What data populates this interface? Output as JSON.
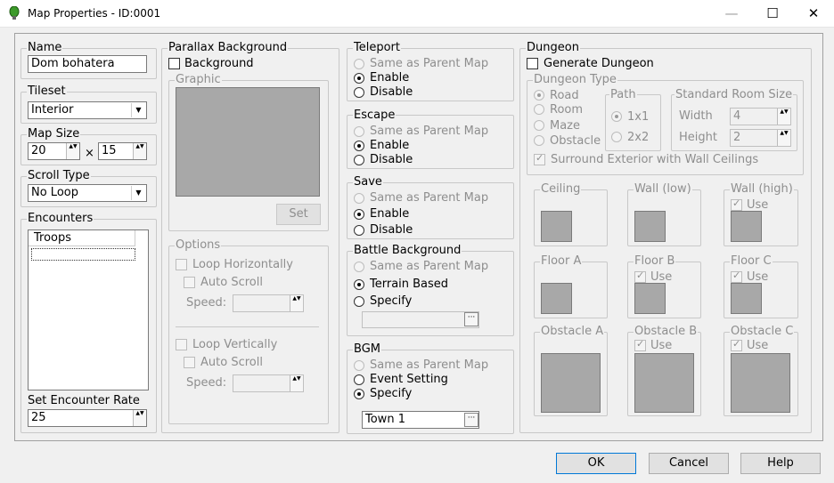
{
  "window": {
    "title": "Map Properties - ID:0001",
    "minimize": "—",
    "maximize": "☐",
    "close": "✕"
  },
  "name": {
    "label": "Name",
    "value": "Dom bohatera"
  },
  "tileset": {
    "label": "Tileset",
    "value": "Interior"
  },
  "map_size": {
    "label": "Map Size",
    "width": "20",
    "height": "15",
    "x": "×"
  },
  "scroll_type": {
    "label": "Scroll Type",
    "value": "No Loop"
  },
  "encounters": {
    "label": "Encounters",
    "column": "Troops",
    "rate_label": "Set Encounter Rate",
    "rate": "25"
  },
  "parallax": {
    "label": "Parallax Background",
    "background": "Background",
    "graphic": "Graphic",
    "set": "Set",
    "options": "Options",
    "loop_h": "Loop Horizontally",
    "loop_v": "Loop Vertically",
    "auto_scroll": "Auto Scroll",
    "speed": "Speed:"
  },
  "teleport": {
    "label": "Teleport",
    "opt1": "Same as Parent Map",
    "opt2": "Enable",
    "opt3": "Disable"
  },
  "escape": {
    "label": "Escape",
    "opt1": "Same as Parent Map",
    "opt2": "Enable",
    "opt3": "Disable"
  },
  "save": {
    "label": "Save",
    "opt1": "Same as Parent Map",
    "opt2": "Enable",
    "opt3": "Disable"
  },
  "battle_bg": {
    "label": "Battle Background",
    "opt1": "Same as Parent Map",
    "opt2": "Terrain Based",
    "opt3": "Specify"
  },
  "bgm": {
    "label": "BGM",
    "opt1": "Same as Parent Map",
    "opt2": "Event Setting",
    "opt3": "Specify",
    "value": "Town 1"
  },
  "dungeon": {
    "label": "Dungeon",
    "generate": "Generate Dungeon",
    "type": "Dungeon Type",
    "road": "Road",
    "room": "Room",
    "maze": "Maze",
    "obstacle": "Obstacle",
    "path": "Path",
    "p1": "1x1",
    "p2": "2x2",
    "room_size": "Standard Room Size",
    "width": "Width",
    "width_val": "4",
    "height": "Height",
    "height_val": "2",
    "surround": "Surround Exterior with Wall Ceilings",
    "ceiling": "Ceiling",
    "wall_low": "Wall (low)",
    "wall_high": "Wall (high)",
    "floor_a": "Floor A",
    "floor_b": "Floor B",
    "floor_c": "Floor C",
    "obstacle_a": "Obstacle A",
    "obstacle_b": "Obstacle B",
    "obstacle_c": "Obstacle C",
    "use": "Use"
  },
  "buttons": {
    "ok": "OK",
    "cancel": "Cancel",
    "help": "Help"
  },
  "ellipsis": "···",
  "spin_glyph": "▲▼"
}
